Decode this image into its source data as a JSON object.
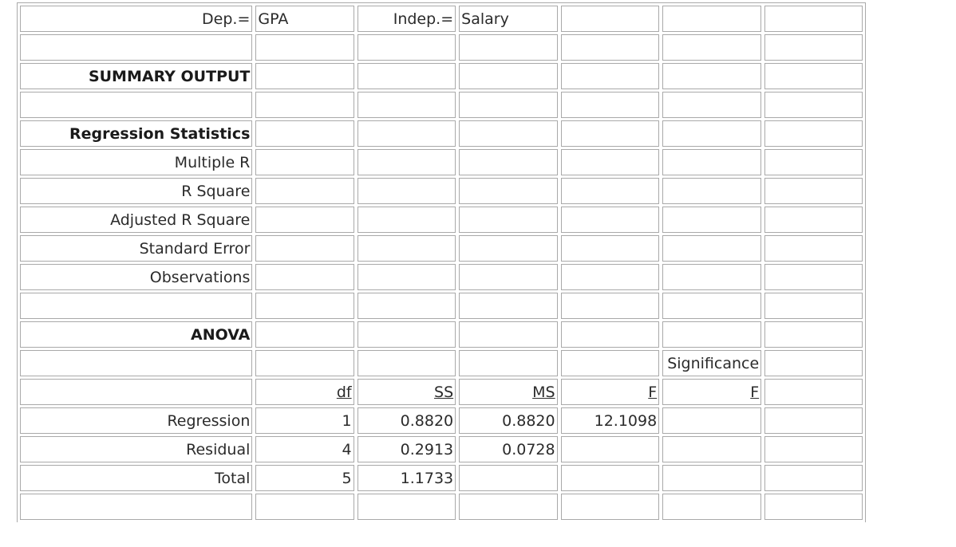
{
  "header": {
    "dep_label": "Dep.=",
    "dep_value": "GPA",
    "indep_label": "Indep.=",
    "indep_value": "Salary"
  },
  "summary_title": "SUMMARY OUTPUT",
  "regression_statistics": {
    "title": "Regression Statistics",
    "rows": [
      "Multiple R",
      "R Square",
      "Adjusted R Square",
      "Standard Error",
      "Observations"
    ]
  },
  "anova": {
    "title": "ANOVA",
    "significance_top": "Significance",
    "headers": [
      "df",
      "SS",
      "MS",
      "F",
      "F"
    ],
    "rows": [
      {
        "label": "Regression",
        "df": "1",
        "ss": "0.8820",
        "ms": "0.8820",
        "f": "12.1098"
      },
      {
        "label": "Residual",
        "df": "4",
        "ss": "0.2913",
        "ms": "0.0728",
        "f": ""
      },
      {
        "label": "Total",
        "df": "5",
        "ss": "1.1733",
        "ms": "",
        "f": ""
      }
    ]
  }
}
